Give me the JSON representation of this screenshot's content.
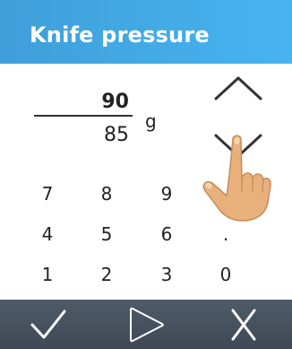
{
  "header": {
    "title": "Knife pressure"
  },
  "value": {
    "new": "90",
    "current": "85",
    "unit": "g"
  },
  "keypad": {
    "keys": [
      "7",
      "8",
      "9",
      "4",
      "5",
      "6",
      ".",
      "1",
      "2",
      "3",
      "0"
    ]
  },
  "icons": {
    "increase": "chevron-up-icon",
    "decrease": "chevron-down-icon",
    "hand": "pointing-hand-icon",
    "confirm": "checkmark-icon",
    "play": "play-icon",
    "cancel": "cancel-x-icon"
  },
  "colors": {
    "header": "#46b4f1",
    "footer": "#46505d",
    "skin": "#e8b07a"
  }
}
